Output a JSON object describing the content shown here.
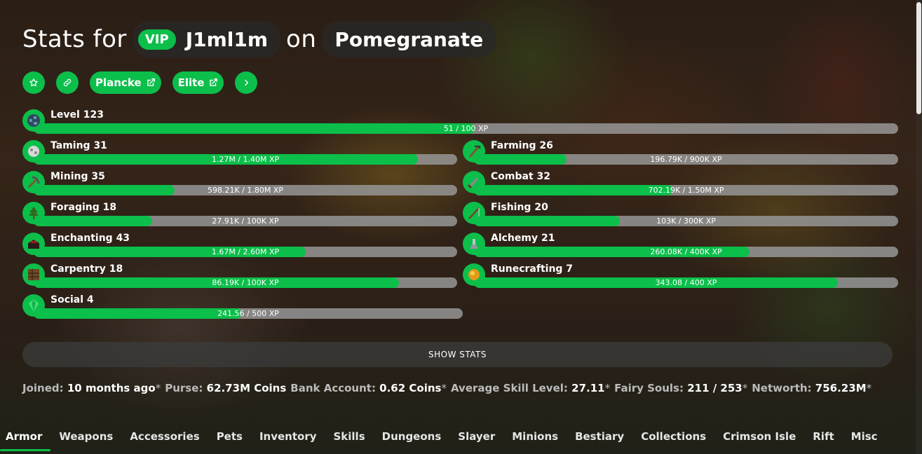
{
  "header": {
    "prefix": "Stats for",
    "rank": "VIP",
    "username": "J1ml1m",
    "on": "on",
    "profile": "Pomegranate"
  },
  "actions": {
    "plancke": "Plancke",
    "elite": "Elite"
  },
  "level": {
    "label": "Level 123",
    "progress": "51 / 100 XP",
    "fraction": 0.51
  },
  "skills_left": [
    {
      "icon": "taming-icon",
      "label": "Taming 31",
      "progress": "1.27M / 1.40M XP",
      "fraction": 0.907
    },
    {
      "icon": "mining-icon",
      "label": "Mining 35",
      "progress": "598.21K / 1.80M XP",
      "fraction": 0.332
    },
    {
      "icon": "foraging-icon",
      "label": "Foraging 18",
      "progress": "27.91K / 100K XP",
      "fraction": 0.279
    },
    {
      "icon": "enchanting-icon",
      "label": "Enchanting 43",
      "progress": "1.67M / 2.60M XP",
      "fraction": 0.642
    },
    {
      "icon": "carpentry-icon",
      "label": "Carpentry 18",
      "progress": "86.19K / 100K XP",
      "fraction": 0.862
    },
    {
      "icon": "social-icon",
      "label": "Social 4",
      "progress": "241.56 / 500 XP",
      "fraction": 0.483
    }
  ],
  "skills_right": [
    {
      "icon": "farming-icon",
      "label": "Farming 26",
      "progress": "196.79K / 900K XP",
      "fraction": 0.219
    },
    {
      "icon": "combat-icon",
      "label": "Combat 32",
      "progress": "702.19K / 1.50M XP",
      "fraction": 0.468
    },
    {
      "icon": "fishing-icon",
      "label": "Fishing 20",
      "progress": "103K / 300K XP",
      "fraction": 0.343
    },
    {
      "icon": "alchemy-icon",
      "label": "Alchemy 21",
      "progress": "260.08K / 400K XP",
      "fraction": 0.65
    },
    {
      "icon": "runecrafting-icon",
      "label": "Runecrafting 7",
      "progress": "343.08 / 400 XP",
      "fraction": 0.858
    }
  ],
  "show_stats": "SHOW STATS",
  "info": [
    {
      "label": "Joined:",
      "value": "10 months ago",
      "star": "*"
    },
    {
      "label": "Purse:",
      "value": "62.73M Coins",
      "star": ""
    },
    {
      "label": "Bank Account:",
      "value": "0.62 Coins",
      "star": "*"
    },
    {
      "label": "Average Skill Level:",
      "value": "27.11",
      "star": "*"
    },
    {
      "label": "Fairy Souls:",
      "value": "211 / 253",
      "star": "*"
    },
    {
      "label": "Networth:",
      "value": "756.23M",
      "star": "*"
    }
  ],
  "tabs": [
    "Armor",
    "Weapons",
    "Accessories",
    "Pets",
    "Inventory",
    "Skills",
    "Dungeons",
    "Slayer",
    "Minions",
    "Bestiary",
    "Collections",
    "Crimson Isle",
    "Rift",
    "Misc"
  ],
  "colors": {
    "accent": "#0bbf4a",
    "bar_track": "#969696"
  }
}
